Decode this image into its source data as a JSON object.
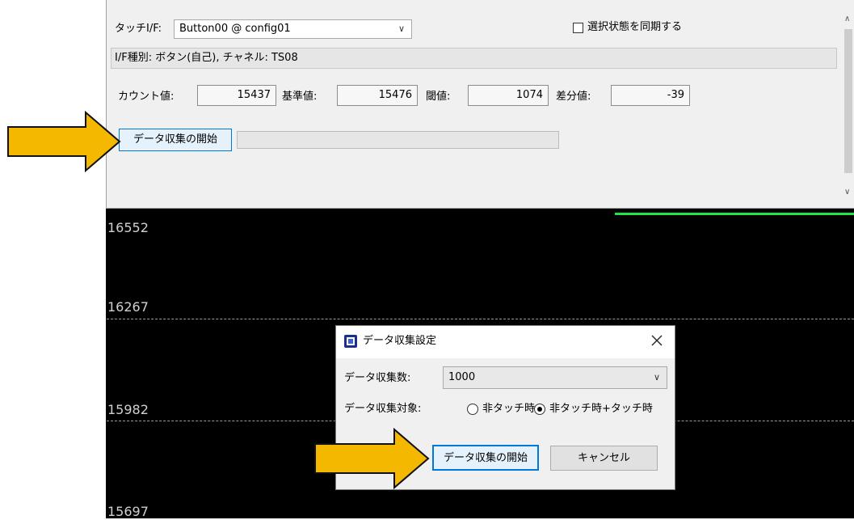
{
  "panel": {
    "touch_if_label": "タッチI/F:",
    "touch_if_value": "Button00 @ config01",
    "sync_label": "選択状態を同期する",
    "info_text": "I/F種別: ボタン(自己), チャネル: TS08",
    "count_label": "カウント値:",
    "count_value": "15437",
    "base_label": "基準値:",
    "base_value": "15476",
    "threshold_label": "閾値:",
    "threshold_value": "1074",
    "diff_label": "差分値:",
    "diff_value": "-39",
    "start_button": "データ収集の開始"
  },
  "graph": {
    "y_labels": [
      "16552",
      "16267",
      "15982",
      "15697"
    ]
  },
  "dialog": {
    "title": "データ収集設定",
    "count_label": "データ収集数:",
    "count_value": "1000",
    "target_label": "データ収集対象:",
    "option_notouch": "非タッチ時",
    "option_both": "非タッチ時+タッチ時",
    "selected_option": "option_both",
    "start_button": "データ収集の開始",
    "cancel_button": "キャンセル"
  },
  "colors": {
    "arrow_fill": "#f5b800",
    "focus_border": "#0078d7",
    "graph_background": "#000000",
    "graph_trace": "#22e24a"
  },
  "icons": [
    "chevron-down-icon",
    "close-icon",
    "app-icon",
    "arrow-right-icon"
  ]
}
